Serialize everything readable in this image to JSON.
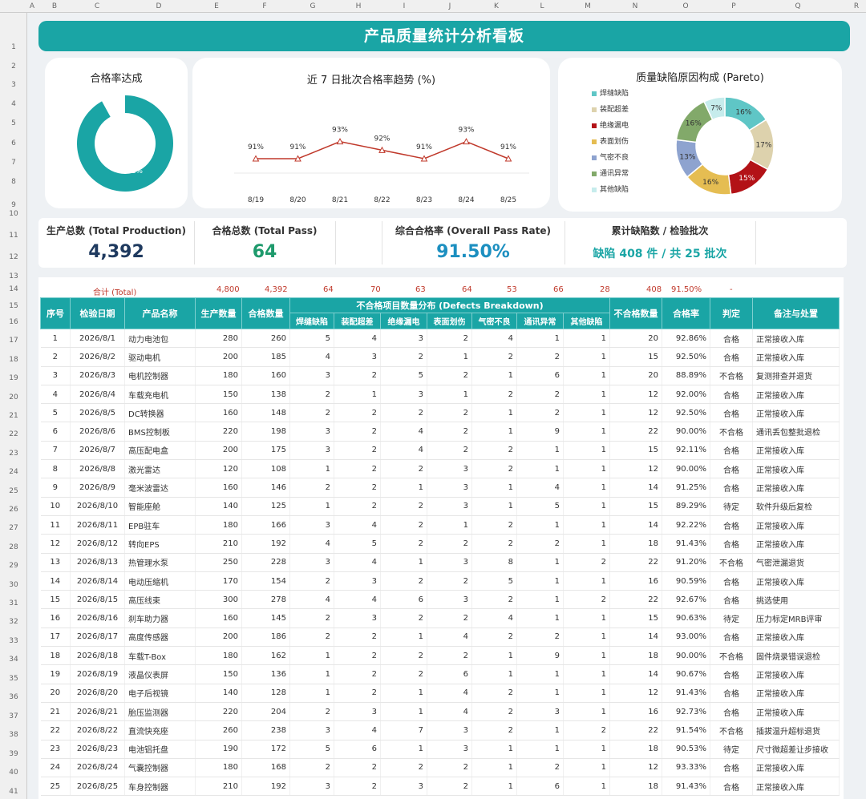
{
  "colhdr": [
    "A",
    "B",
    "C",
    "D",
    "E",
    "F",
    "G",
    "H",
    "I",
    "J",
    "K",
    "L",
    "M",
    "N",
    "O",
    "P",
    "Q",
    "R"
  ],
  "rowhdr": [
    "1",
    "2",
    "3",
    "4",
    "5",
    "6",
    "7",
    "8",
    "9",
    "10",
    "11",
    "12",
    "13",
    "14",
    "15",
    "16",
    "17",
    "18",
    "19",
    "20",
    "21",
    "22",
    "23",
    "24",
    "25",
    "26",
    "27",
    "28",
    "29",
    "30",
    "31",
    "32",
    "33",
    "34",
    "35",
    "36",
    "37",
    "38",
    "39",
    "40",
    "41"
  ],
  "title": "产品质量统计分析看板",
  "donut": {
    "title": "合格率达成",
    "label": "92%",
    "value": 0.92,
    "color": "#1aa5a5"
  },
  "trend": {
    "title": "近 7 日批次合格率趋势 (%)",
    "x": [
      "8/19",
      "8/20",
      "8/21",
      "8/22",
      "8/23",
      "8/24",
      "8/25"
    ],
    "y": [
      91,
      91,
      93,
      92,
      91,
      93,
      91
    ],
    "labels": [
      "91%",
      "91%",
      "93%",
      "92%",
      "91%",
      "93%",
      "91%"
    ],
    "color": "#c0392b"
  },
  "pareto": {
    "title": "质量缺陷原因构成 (Pareto)",
    "items": [
      {
        "name": "焊缝缺陷",
        "label": "16%",
        "value": 16,
        "color": "#5fc6c6"
      },
      {
        "name": "装配超差",
        "label": "17%",
        "value": 17,
        "color": "#ddd2ad"
      },
      {
        "name": "绝缘漏电",
        "label": "15%",
        "value": 15,
        "color": "#b31217"
      },
      {
        "name": "表面划伤",
        "label": "16%",
        "value": 16,
        "color": "#e5bd52"
      },
      {
        "name": "气密不良",
        "label": "13%",
        "value": 13,
        "color": "#8ea3cf"
      },
      {
        "name": "通讯异常",
        "label": "16%",
        "value": 16,
        "color": "#82a96a"
      },
      {
        "name": "其他缺陷",
        "label": "7%",
        "value": 7,
        "color": "#c6ecec"
      }
    ]
  },
  "kpi": {
    "total_production_label": "生产总数 (Total Production)",
    "total_production": "4,392",
    "total_pass_label": "合格总数 (Total Pass)",
    "total_pass": "64",
    "pass_rate_label": "综合合格率 (Overall Pass Rate)",
    "pass_rate": "91.50%",
    "defects_label": "累计缺陷数 / 检验批次",
    "defects": "缺陷 408 件 / 共 25 批次"
  },
  "totals": {
    "label": "合计 (Total)",
    "production": "4,800",
    "pass": "4,392",
    "d1": "64",
    "d2": "70",
    "d3": "63",
    "d4": "64",
    "d5": "53",
    "d6": "66",
    "d7": "28",
    "fail": "408",
    "rate": "91.50%",
    "judge": "-"
  },
  "headers": {
    "seq": "序号",
    "date": "检验日期",
    "product": "产品名称",
    "production": "生产数量",
    "pass": "合格数量",
    "defects_group": "不合格项目数量分布 (Defects Breakdown)",
    "defects": [
      "焊缝缺陷",
      "装配超差",
      "绝缘漏电",
      "表面划伤",
      "气密不良",
      "通讯异常",
      "其他缺陷"
    ],
    "fail": "不合格数量",
    "rate": "合格率",
    "judge": "判定",
    "note": "备注与处置"
  },
  "rows": [
    [
      "1",
      "2026/8/1",
      "动力电池包",
      "280",
      "260",
      "5",
      "4",
      "3",
      "2",
      "4",
      "1",
      "1",
      "20",
      "92.86%",
      "合格",
      "正常接收入库"
    ],
    [
      "2",
      "2026/8/2",
      "驱动电机",
      "200",
      "185",
      "4",
      "3",
      "2",
      "1",
      "2",
      "2",
      "1",
      "15",
      "92.50%",
      "合格",
      "正常接收入库"
    ],
    [
      "3",
      "2026/8/3",
      "电机控制器",
      "180",
      "160",
      "3",
      "2",
      "5",
      "2",
      "1",
      "6",
      "1",
      "20",
      "88.89%",
      "不合格",
      "复测排查并退货"
    ],
    [
      "4",
      "2026/8/4",
      "车载充电机",
      "150",
      "138",
      "2",
      "1",
      "3",
      "1",
      "2",
      "2",
      "1",
      "12",
      "92.00%",
      "合格",
      "正常接收入库"
    ],
    [
      "5",
      "2026/8/5",
      "DC转换器",
      "160",
      "148",
      "2",
      "2",
      "2",
      "2",
      "1",
      "2",
      "1",
      "12",
      "92.50%",
      "合格",
      "正常接收入库"
    ],
    [
      "6",
      "2026/8/6",
      "BMS控制板",
      "220",
      "198",
      "3",
      "2",
      "4",
      "2",
      "1",
      "9",
      "1",
      "22",
      "90.00%",
      "不合格",
      "通讯丢包整批退检"
    ],
    [
      "7",
      "2026/8/7",
      "高压配电盒",
      "200",
      "175",
      "3",
      "2",
      "4",
      "2",
      "2",
      "1",
      "1",
      "15",
      "92.11%",
      "合格",
      "正常接收入库"
    ],
    [
      "8",
      "2026/8/8",
      "激光雷达",
      "120",
      "108",
      "1",
      "2",
      "2",
      "3",
      "2",
      "1",
      "1",
      "12",
      "90.00%",
      "合格",
      "正常接收入库"
    ],
    [
      "9",
      "2026/8/9",
      "毫米波雷达",
      "160",
      "146",
      "2",
      "2",
      "1",
      "3",
      "1",
      "4",
      "1",
      "14",
      "91.25%",
      "合格",
      "正常接收入库"
    ],
    [
      "10",
      "2026/8/10",
      "智能座舱",
      "140",
      "125",
      "1",
      "2",
      "2",
      "3",
      "1",
      "5",
      "1",
      "15",
      "89.29%",
      "待定",
      "软件升级后复检"
    ],
    [
      "11",
      "2026/8/11",
      "EPB驻车",
      "180",
      "166",
      "3",
      "4",
      "2",
      "1",
      "2",
      "1",
      "1",
      "14",
      "92.22%",
      "合格",
      "正常接收入库"
    ],
    [
      "12",
      "2026/8/12",
      "转向EPS",
      "210",
      "192",
      "4",
      "5",
      "2",
      "2",
      "2",
      "2",
      "1",
      "18",
      "91.43%",
      "合格",
      "正常接收入库"
    ],
    [
      "13",
      "2026/8/13",
      "热管理水泵",
      "250",
      "228",
      "3",
      "4",
      "1",
      "3",
      "8",
      "1",
      "2",
      "22",
      "91.20%",
      "不合格",
      "气密泄漏退货"
    ],
    [
      "14",
      "2026/8/14",
      "电动压缩机",
      "170",
      "154",
      "2",
      "3",
      "2",
      "2",
      "5",
      "1",
      "1",
      "16",
      "90.59%",
      "合格",
      "正常接收入库"
    ],
    [
      "15",
      "2026/8/15",
      "高压线束",
      "300",
      "278",
      "4",
      "4",
      "6",
      "3",
      "2",
      "1",
      "2",
      "22",
      "92.67%",
      "合格",
      "挑选使用"
    ],
    [
      "16",
      "2026/8/16",
      "刹车助力器",
      "160",
      "145",
      "2",
      "3",
      "2",
      "2",
      "4",
      "1",
      "1",
      "15",
      "90.63%",
      "待定",
      "压力标定MRB评审"
    ],
    [
      "17",
      "2026/8/17",
      "高度传感器",
      "200",
      "186",
      "2",
      "2",
      "1",
      "4",
      "2",
      "2",
      "1",
      "14",
      "93.00%",
      "合格",
      "正常接收入库"
    ],
    [
      "18",
      "2026/8/18",
      "车载T-Box",
      "180",
      "162",
      "1",
      "2",
      "2",
      "2",
      "1",
      "9",
      "1",
      "18",
      "90.00%",
      "不合格",
      "固件烧录错误退检"
    ],
    [
      "19",
      "2026/8/19",
      "液晶仪表屏",
      "150",
      "136",
      "1",
      "2",
      "2",
      "6",
      "1",
      "1",
      "1",
      "14",
      "90.67%",
      "合格",
      "正常接收入库"
    ],
    [
      "20",
      "2026/8/20",
      "电子后视镜",
      "140",
      "128",
      "1",
      "2",
      "1",
      "4",
      "2",
      "1",
      "1",
      "12",
      "91.43%",
      "合格",
      "正常接收入库"
    ],
    [
      "21",
      "2026/8/21",
      "胎压监测器",
      "220",
      "204",
      "2",
      "3",
      "1",
      "4",
      "2",
      "3",
      "1",
      "16",
      "92.73%",
      "合格",
      "正常接收入库"
    ],
    [
      "22",
      "2026/8/22",
      "直流快充座",
      "260",
      "238",
      "3",
      "4",
      "7",
      "3",
      "2",
      "1",
      "2",
      "22",
      "91.54%",
      "不合格",
      "插拔温升超标退货"
    ],
    [
      "23",
      "2026/8/23",
      "电池铝托盘",
      "190",
      "172",
      "5",
      "6",
      "1",
      "3",
      "1",
      "1",
      "1",
      "18",
      "90.53%",
      "待定",
      "尺寸微超差让步接收"
    ],
    [
      "24",
      "2026/8/24",
      "气囊控制器",
      "180",
      "168",
      "2",
      "2",
      "2",
      "2",
      "1",
      "2",
      "1",
      "12",
      "93.33%",
      "合格",
      "正常接收入库"
    ],
    [
      "25",
      "2026/8/25",
      "车身控制器",
      "210",
      "192",
      "3",
      "2",
      "3",
      "2",
      "1",
      "6",
      "1",
      "18",
      "91.43%",
      "合格",
      "正常接收入库"
    ]
  ]
}
